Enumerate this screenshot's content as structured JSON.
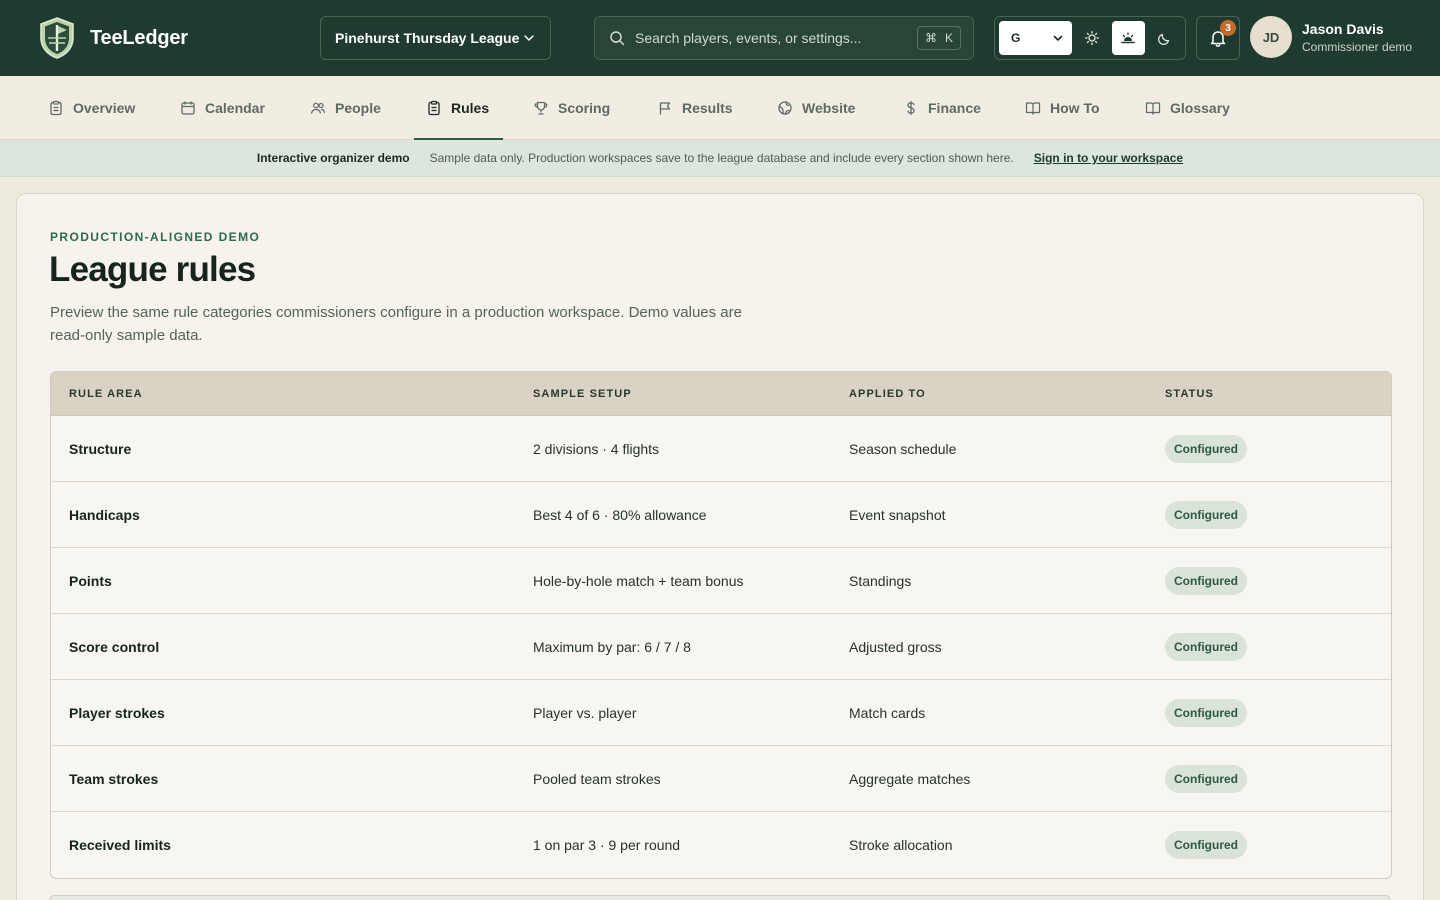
{
  "brand": {
    "name": "TeeLedger",
    "logo_icon": "shield-flag-icon"
  },
  "league_selector": {
    "value": "Pinehurst Thursday League"
  },
  "search": {
    "placeholder": "Search players, events, or settings...",
    "shortcut_symbol": "⌘",
    "shortcut_key": "K"
  },
  "theme": {
    "selected": "G",
    "modes": [
      "light",
      "sunrise",
      "dark"
    ],
    "active_mode": "sunrise"
  },
  "notifications": {
    "count": "3"
  },
  "user": {
    "initials": "JD",
    "name": "Jason Davis",
    "role": "Commissioner demo"
  },
  "tabs": [
    {
      "label": "Overview",
      "icon": "clipboard-icon"
    },
    {
      "label": "Calendar",
      "icon": "calendar-icon"
    },
    {
      "label": "People",
      "icon": "people-icon"
    },
    {
      "label": "Rules",
      "icon": "clipboard-icon",
      "active": true
    },
    {
      "label": "Scoring",
      "icon": "trophy-icon"
    },
    {
      "label": "Results",
      "icon": "flag-icon"
    },
    {
      "label": "Website",
      "icon": "globe-icon"
    },
    {
      "label": "Finance",
      "icon": "dollar-icon"
    },
    {
      "label": "How To",
      "icon": "book-icon"
    },
    {
      "label": "Glossary",
      "icon": "book-icon"
    }
  ],
  "banner": {
    "title": "Interactive organizer demo",
    "text": "Sample data only. Production workspaces save to the league database and include every section shown here.",
    "link": "Sign in to your workspace"
  },
  "main": {
    "eyebrow": "PRODUCTION-ALIGNED DEMO",
    "title": "League rules",
    "description": "Preview the same rule categories commissioners configure in a production workspace. Demo values are read-only sample data."
  },
  "rules_table": {
    "headers": [
      "RULE AREA",
      "SAMPLE SETUP",
      "APPLIED TO",
      "STATUS"
    ],
    "rows": [
      {
        "area": "Structure",
        "setup": "2 divisions · 4 flights",
        "applied": "Season schedule",
        "status": "Configured"
      },
      {
        "area": "Handicaps",
        "setup": "Best 4 of 6 · 80% allowance",
        "applied": "Event snapshot",
        "status": "Configured"
      },
      {
        "area": "Points",
        "setup": "Hole-by-hole match + team bonus",
        "applied": "Standings",
        "status": "Configured"
      },
      {
        "area": "Score control",
        "setup": "Maximum by par: 6 / 7 / 8",
        "applied": "Adjusted gross",
        "status": "Configured"
      },
      {
        "area": "Player strokes",
        "setup": "Player vs. player",
        "applied": "Match cards",
        "status": "Configured"
      },
      {
        "area": "Team strokes",
        "setup": "Pooled team strokes",
        "applied": "Aggregate matches",
        "status": "Configured"
      },
      {
        "area": "Received limits",
        "setup": "1 on par 3 · 9 per round",
        "applied": "Stroke allocation",
        "status": "Configured"
      }
    ]
  },
  "colors": {
    "header_bg": "#1f3a2e",
    "accent": "#2f5a45",
    "status_pill_bg": "#d9e4d7",
    "badge": "#c76a2b"
  }
}
